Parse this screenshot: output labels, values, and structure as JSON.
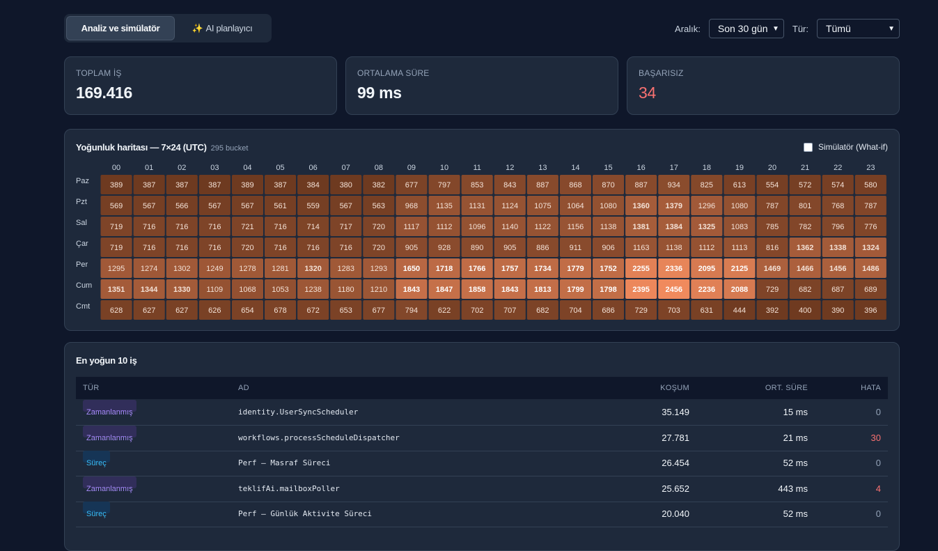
{
  "tabs": [
    {
      "label": "Analiz ve simülatör",
      "active": true
    },
    {
      "label": "AI planlayıcı",
      "icon": "sparkles-icon",
      "glyph": "✨",
      "active": false
    }
  ],
  "filters": {
    "range_label": "Aralık:",
    "range_value": "Son 30 gün",
    "type_label": "Tür:",
    "type_value": "Tümü"
  },
  "stats": [
    {
      "title": "TOPLAM İŞ",
      "value": "169.416"
    },
    {
      "title": "ORTALAMA SÜRE",
      "value": "99 ms"
    },
    {
      "title": "BAŞARISIZ",
      "value": "34",
      "color": "#f87171"
    }
  ],
  "heatmap": {
    "title": "Yoğunluk haritası — 7×24 (UTC)",
    "subtitle": "295 bucket",
    "simulator_label": "Simülatör (What-if)",
    "hours": [
      "00",
      "01",
      "02",
      "03",
      "04",
      "05",
      "06",
      "07",
      "08",
      "09",
      "10",
      "11",
      "12",
      "13",
      "14",
      "15",
      "16",
      "17",
      "18",
      "19",
      "20",
      "21",
      "22",
      "23"
    ],
    "days": [
      "Paz",
      "Pzt",
      "Sal",
      "Çar",
      "Per",
      "Cum",
      "Cmt"
    ],
    "values": [
      [
        389,
        387,
        387,
        387,
        389,
        387,
        384,
        380,
        382,
        677,
        797,
        853,
        843,
        887,
        868,
        870,
        887,
        934,
        825,
        613,
        554,
        572,
        574,
        580
      ],
      [
        569,
        567,
        566,
        567,
        567,
        561,
        559,
        567,
        563,
        968,
        1135,
        1131,
        1124,
        1075,
        1064,
        1080,
        1360,
        1379,
        1296,
        1080,
        787,
        801,
        768,
        787
      ],
      [
        719,
        716,
        716,
        716,
        721,
        716,
        714,
        717,
        720,
        1117,
        1112,
        1096,
        1140,
        1122,
        1156,
        1138,
        1381,
        1384,
        1325,
        1083,
        785,
        782,
        796,
        776
      ],
      [
        719,
        716,
        716,
        716,
        720,
        716,
        716,
        716,
        720,
        905,
        928,
        890,
        905,
        886,
        911,
        906,
        1163,
        1138,
        1112,
        1113,
        816,
        1362,
        1338,
        1324
      ],
      [
        1295,
        1274,
        1302,
        1249,
        1278,
        1281,
        1320,
        1283,
        1293,
        1650,
        1718,
        1766,
        1757,
        1734,
        1779,
        1752,
        2255,
        2336,
        2095,
        2125,
        1469,
        1466,
        1456,
        1486
      ],
      [
        1351,
        1344,
        1330,
        1109,
        1068,
        1053,
        1238,
        1180,
        1210,
        1843,
        1847,
        1858,
        1843,
        1813,
        1799,
        1798,
        2395,
        2456,
        2236,
        2088,
        729,
        682,
        687,
        689
      ],
      [
        628,
        627,
        627,
        626,
        654,
        678,
        672,
        653,
        677,
        794,
        622,
        702,
        707,
        682,
        704,
        686,
        729,
        703,
        631,
        444,
        392,
        400,
        390,
        396
      ]
    ],
    "color_low": "#6e3a20",
    "color_high": "#f08a5d"
  },
  "top_jobs": {
    "title": "En yoğun 10 iş",
    "columns": {
      "type": "TÜR",
      "name": "AD",
      "runs": "KOŞUM",
      "avg": "ORT. SÜRE",
      "errors": "HATA"
    },
    "rows": [
      {
        "type": "Zamanlanmış",
        "kind": "sched",
        "name": "identity.UserSyncScheduler",
        "runs": "35.149",
        "avg": "15 ms",
        "errors": "0"
      },
      {
        "type": "Zamanlanmış",
        "kind": "sched",
        "name": "workflows.processScheduleDispatcher",
        "runs": "27.781",
        "avg": "21 ms",
        "errors": "30"
      },
      {
        "type": "Süreç",
        "kind": "proc",
        "name": "Perf — Masraf Süreci",
        "runs": "26.454",
        "avg": "52 ms",
        "errors": "0"
      },
      {
        "type": "Zamanlanmış",
        "kind": "sched",
        "name": "teklifAi.mailboxPoller",
        "runs": "25.652",
        "avg": "443 ms",
        "errors": "4"
      },
      {
        "type": "Süreç",
        "kind": "proc",
        "name": "Perf — Günlük Aktivite Süreci",
        "runs": "20.040",
        "avg": "52 ms",
        "errors": "0"
      }
    ]
  }
}
